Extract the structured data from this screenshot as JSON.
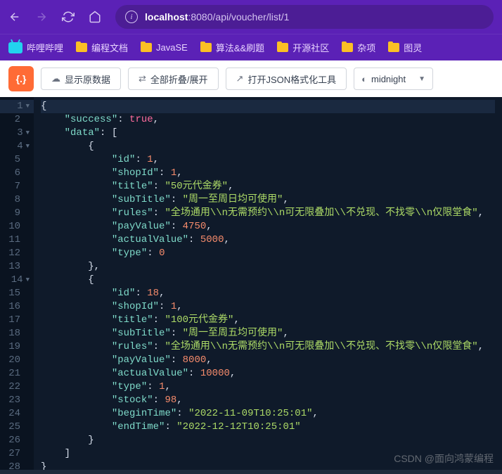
{
  "browser": {
    "url_host": "localhost",
    "url_port": ":8080",
    "url_path": "/api/voucher/list/1"
  },
  "bookmarks": [
    {
      "icon": "bili",
      "label": "哔哩哔哩"
    },
    {
      "icon": "folder",
      "label": "编程文档"
    },
    {
      "icon": "folder",
      "label": "JavaSE"
    },
    {
      "icon": "folder",
      "label": "算法&&刷题"
    },
    {
      "icon": "folder",
      "label": "开源社区"
    },
    {
      "icon": "folder",
      "label": "杂项"
    },
    {
      "icon": "folder",
      "label": "图灵"
    }
  ],
  "toolbar": {
    "logo": "{.}",
    "raw_btn": "显示原数据",
    "fold_btn": "全部折叠/展开",
    "format_btn": "打开JSON格式化工具",
    "theme": "midnight"
  },
  "json_view": {
    "lines": [
      {
        "n": 1,
        "fold": true,
        "indent": 0,
        "tokens": [
          {
            "t": "p",
            "v": "{"
          }
        ]
      },
      {
        "n": 2,
        "indent": 1,
        "tokens": [
          {
            "t": "k",
            "v": "\"success\""
          },
          {
            "t": "p",
            "v": ": "
          },
          {
            "t": "b",
            "v": "true"
          },
          {
            "t": "p",
            "v": ","
          }
        ]
      },
      {
        "n": 3,
        "fold": true,
        "indent": 1,
        "tokens": [
          {
            "t": "k",
            "v": "\"data\""
          },
          {
            "t": "p",
            "v": ": ["
          }
        ]
      },
      {
        "n": 4,
        "fold": true,
        "indent": 2,
        "tokens": [
          {
            "t": "p",
            "v": "{"
          }
        ]
      },
      {
        "n": 5,
        "indent": 3,
        "tokens": [
          {
            "t": "k",
            "v": "\"id\""
          },
          {
            "t": "p",
            "v": ": "
          },
          {
            "t": "n",
            "v": "1"
          },
          {
            "t": "p",
            "v": ","
          }
        ]
      },
      {
        "n": 6,
        "indent": 3,
        "tokens": [
          {
            "t": "k",
            "v": "\"shopId\""
          },
          {
            "t": "p",
            "v": ": "
          },
          {
            "t": "n",
            "v": "1"
          },
          {
            "t": "p",
            "v": ","
          }
        ]
      },
      {
        "n": 7,
        "indent": 3,
        "tokens": [
          {
            "t": "k",
            "v": "\"title\""
          },
          {
            "t": "p",
            "v": ": "
          },
          {
            "t": "s",
            "v": "\"50元代金券\""
          },
          {
            "t": "p",
            "v": ","
          }
        ]
      },
      {
        "n": 8,
        "indent": 3,
        "tokens": [
          {
            "t": "k",
            "v": "\"subTitle\""
          },
          {
            "t": "p",
            "v": ": "
          },
          {
            "t": "s",
            "v": "\"周一至周日均可使用\""
          },
          {
            "t": "p",
            "v": ","
          }
        ]
      },
      {
        "n": 9,
        "indent": 3,
        "tokens": [
          {
            "t": "k",
            "v": "\"rules\""
          },
          {
            "t": "p",
            "v": ": "
          },
          {
            "t": "s",
            "v": "\"全场通用\\\\n无需预约\\\\n可无限叠加\\\\不兑现、不找零\\\\n仅限堂食\""
          },
          {
            "t": "p",
            "v": ","
          }
        ]
      },
      {
        "n": 10,
        "indent": 3,
        "tokens": [
          {
            "t": "k",
            "v": "\"payValue\""
          },
          {
            "t": "p",
            "v": ": "
          },
          {
            "t": "n",
            "v": "4750"
          },
          {
            "t": "p",
            "v": ","
          }
        ]
      },
      {
        "n": 11,
        "indent": 3,
        "tokens": [
          {
            "t": "k",
            "v": "\"actualValue\""
          },
          {
            "t": "p",
            "v": ": "
          },
          {
            "t": "n",
            "v": "5000"
          },
          {
            "t": "p",
            "v": ","
          }
        ]
      },
      {
        "n": 12,
        "indent": 3,
        "tokens": [
          {
            "t": "k",
            "v": "\"type\""
          },
          {
            "t": "p",
            "v": ": "
          },
          {
            "t": "n",
            "v": "0"
          }
        ]
      },
      {
        "n": 13,
        "indent": 2,
        "tokens": [
          {
            "t": "p",
            "v": "},"
          }
        ]
      },
      {
        "n": 14,
        "fold": true,
        "indent": 2,
        "tokens": [
          {
            "t": "p",
            "v": "{"
          }
        ]
      },
      {
        "n": 15,
        "indent": 3,
        "tokens": [
          {
            "t": "k",
            "v": "\"id\""
          },
          {
            "t": "p",
            "v": ": "
          },
          {
            "t": "n",
            "v": "18"
          },
          {
            "t": "p",
            "v": ","
          }
        ]
      },
      {
        "n": 16,
        "indent": 3,
        "tokens": [
          {
            "t": "k",
            "v": "\"shopId\""
          },
          {
            "t": "p",
            "v": ": "
          },
          {
            "t": "n",
            "v": "1"
          },
          {
            "t": "p",
            "v": ","
          }
        ]
      },
      {
        "n": 17,
        "indent": 3,
        "tokens": [
          {
            "t": "k",
            "v": "\"title\""
          },
          {
            "t": "p",
            "v": ": "
          },
          {
            "t": "s",
            "v": "\"100元代金券\""
          },
          {
            "t": "p",
            "v": ","
          }
        ]
      },
      {
        "n": 18,
        "indent": 3,
        "tokens": [
          {
            "t": "k",
            "v": "\"subTitle\""
          },
          {
            "t": "p",
            "v": ": "
          },
          {
            "t": "s",
            "v": "\"周一至周五均可使用\""
          },
          {
            "t": "p",
            "v": ","
          }
        ]
      },
      {
        "n": 19,
        "indent": 3,
        "tokens": [
          {
            "t": "k",
            "v": "\"rules\""
          },
          {
            "t": "p",
            "v": ": "
          },
          {
            "t": "s",
            "v": "\"全场通用\\\\n无需预约\\\\n可无限叠加\\\\不兑现、不找零\\\\n仅限堂食\""
          },
          {
            "t": "p",
            "v": ","
          }
        ]
      },
      {
        "n": 20,
        "indent": 3,
        "tokens": [
          {
            "t": "k",
            "v": "\"payValue\""
          },
          {
            "t": "p",
            "v": ": "
          },
          {
            "t": "n",
            "v": "8000"
          },
          {
            "t": "p",
            "v": ","
          }
        ]
      },
      {
        "n": 21,
        "indent": 3,
        "tokens": [
          {
            "t": "k",
            "v": "\"actualValue\""
          },
          {
            "t": "p",
            "v": ": "
          },
          {
            "t": "n",
            "v": "10000"
          },
          {
            "t": "p",
            "v": ","
          }
        ]
      },
      {
        "n": 22,
        "indent": 3,
        "tokens": [
          {
            "t": "k",
            "v": "\"type\""
          },
          {
            "t": "p",
            "v": ": "
          },
          {
            "t": "n",
            "v": "1"
          },
          {
            "t": "p",
            "v": ","
          }
        ]
      },
      {
        "n": 23,
        "indent": 3,
        "tokens": [
          {
            "t": "k",
            "v": "\"stock\""
          },
          {
            "t": "p",
            "v": ": "
          },
          {
            "t": "n",
            "v": "98"
          },
          {
            "t": "p",
            "v": ","
          }
        ]
      },
      {
        "n": 24,
        "indent": 3,
        "tokens": [
          {
            "t": "k",
            "v": "\"beginTime\""
          },
          {
            "t": "p",
            "v": ": "
          },
          {
            "t": "s",
            "v": "\"2022-11-09T10:25:01\""
          },
          {
            "t": "p",
            "v": ","
          }
        ]
      },
      {
        "n": 25,
        "indent": 3,
        "tokens": [
          {
            "t": "k",
            "v": "\"endTime\""
          },
          {
            "t": "p",
            "v": ": "
          },
          {
            "t": "s",
            "v": "\"2022-12-12T10:25:01\""
          }
        ]
      },
      {
        "n": 26,
        "indent": 2,
        "tokens": [
          {
            "t": "p",
            "v": "}"
          }
        ]
      },
      {
        "n": 27,
        "indent": 1,
        "tokens": [
          {
            "t": "p",
            "v": "]"
          }
        ]
      },
      {
        "n": 28,
        "indent": 0,
        "tokens": [
          {
            "t": "p",
            "v": "}"
          }
        ]
      }
    ]
  },
  "watermark": "CSDN @面向鸿蒙编程"
}
